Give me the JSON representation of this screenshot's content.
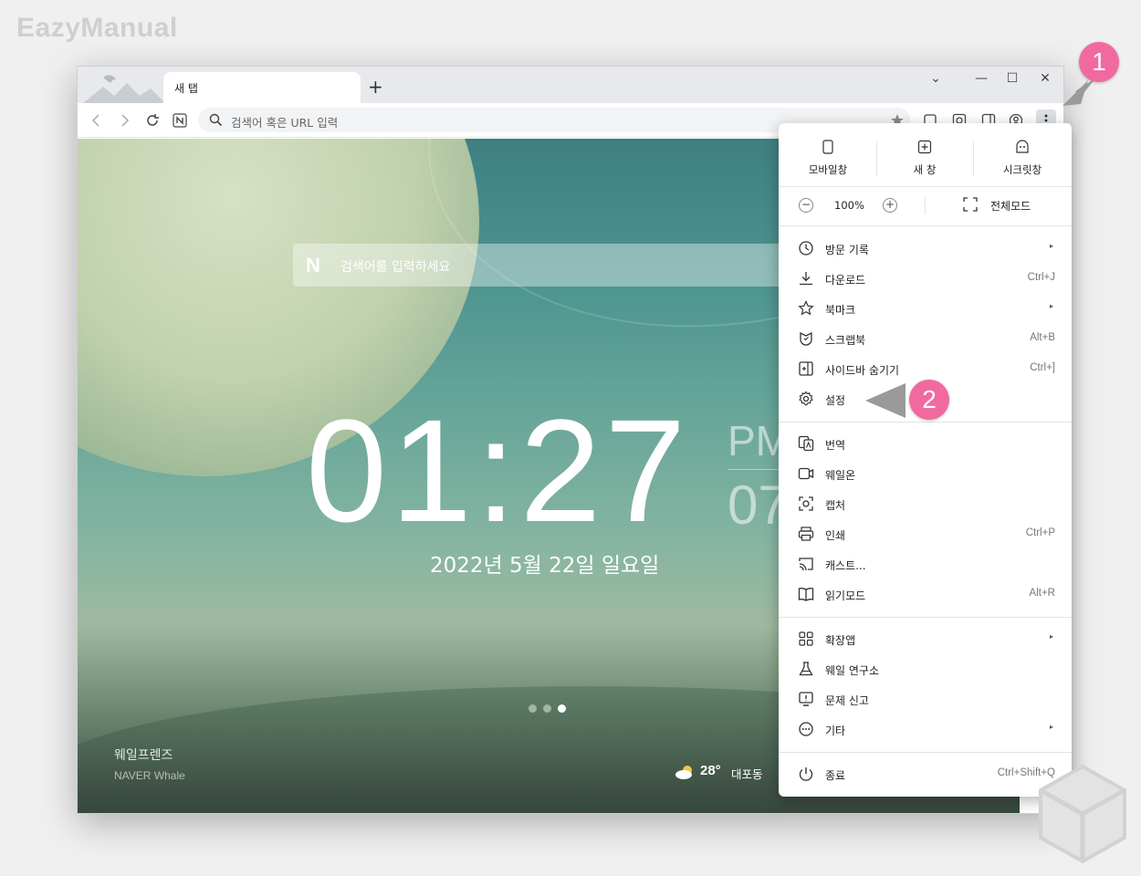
{
  "watermark": "EazyManual",
  "tab": {
    "title": "새 탭"
  },
  "new_tab_glyph": "+",
  "window_controls": {
    "dropdown": "⌄",
    "minimize": "—",
    "maximize": "☐",
    "close": "✕"
  },
  "address_bar": {
    "placeholder": "검색어 혹은 URL 입력"
  },
  "newtab_page": {
    "search_logo": "N",
    "search_placeholder": "검색어를 입력하세요",
    "clock": "01:27",
    "ampm": "PM",
    "seconds": "07",
    "date": "2022년 5월 22일 일요일",
    "carousel": {
      "total": 3,
      "active_index": 3
    },
    "brand_title": "웨일프렌즈",
    "brand_sub": "NAVER Whale",
    "weather": {
      "temp": "28°",
      "location": "대포동"
    }
  },
  "menu": {
    "quick": [
      {
        "icon": "mobile-window-icon",
        "label": "모바일창"
      },
      {
        "icon": "new-window-icon",
        "label": "새 창"
      },
      {
        "icon": "secret-window-icon",
        "label": "시크릿창"
      }
    ],
    "zoom": {
      "minus": "−",
      "value": "100%",
      "plus": "+",
      "fullscreen": "전체모드"
    },
    "group1": [
      {
        "icon": "history-icon",
        "label": "방문 기록",
        "shortcut": "",
        "submenu": true
      },
      {
        "icon": "download-icon",
        "label": "다운로드",
        "shortcut": "Ctrl+J",
        "submenu": false
      },
      {
        "icon": "star-icon",
        "label": "북마크",
        "shortcut": "",
        "submenu": true
      },
      {
        "icon": "scrapbook-icon",
        "label": "스크랩북",
        "shortcut": "Alt+B",
        "submenu": false
      },
      {
        "icon": "sidebar-icon",
        "label": "사이드바 숨기기",
        "shortcut": "Ctrl+]",
        "submenu": false
      },
      {
        "icon": "gear-icon",
        "label": "설정",
        "shortcut": "",
        "submenu": false
      }
    ],
    "group2": [
      {
        "icon": "translate-icon",
        "label": "번역",
        "shortcut": "",
        "submenu": false
      },
      {
        "icon": "whale-on-icon",
        "label": "웨일온",
        "shortcut": "",
        "submenu": false
      },
      {
        "icon": "capture-icon",
        "label": "캡처",
        "shortcut": "",
        "submenu": false
      },
      {
        "icon": "print-icon",
        "label": "인쇄",
        "shortcut": "Ctrl+P",
        "submenu": false
      },
      {
        "icon": "cast-icon",
        "label": "캐스트...",
        "shortcut": "",
        "submenu": false
      },
      {
        "icon": "reading-mode-icon",
        "label": "읽기모드",
        "shortcut": "Alt+R",
        "submenu": false
      }
    ],
    "group3": [
      {
        "icon": "extensions-icon",
        "label": "확장앱",
        "shortcut": "",
        "submenu": true
      },
      {
        "icon": "lab-icon",
        "label": "웨일 연구소",
        "shortcut": "",
        "submenu": false
      },
      {
        "icon": "report-icon",
        "label": "문제 신고",
        "shortcut": "",
        "submenu": false
      },
      {
        "icon": "more-icon",
        "label": "기타",
        "shortcut": "",
        "submenu": true
      }
    ],
    "exit": {
      "icon": "power-icon",
      "label": "종료",
      "shortcut": "Ctrl+Shift+Q"
    },
    "submenu_glyph": "▸"
  },
  "annotations": [
    {
      "number": "1",
      "target": "menu-button"
    },
    {
      "number": "2",
      "target": "menu-item-settings"
    }
  ],
  "colors": {
    "badge": "#f06aa0",
    "arrow": "#9a9a9a",
    "menu_button_bg": "#dcdfe3"
  }
}
